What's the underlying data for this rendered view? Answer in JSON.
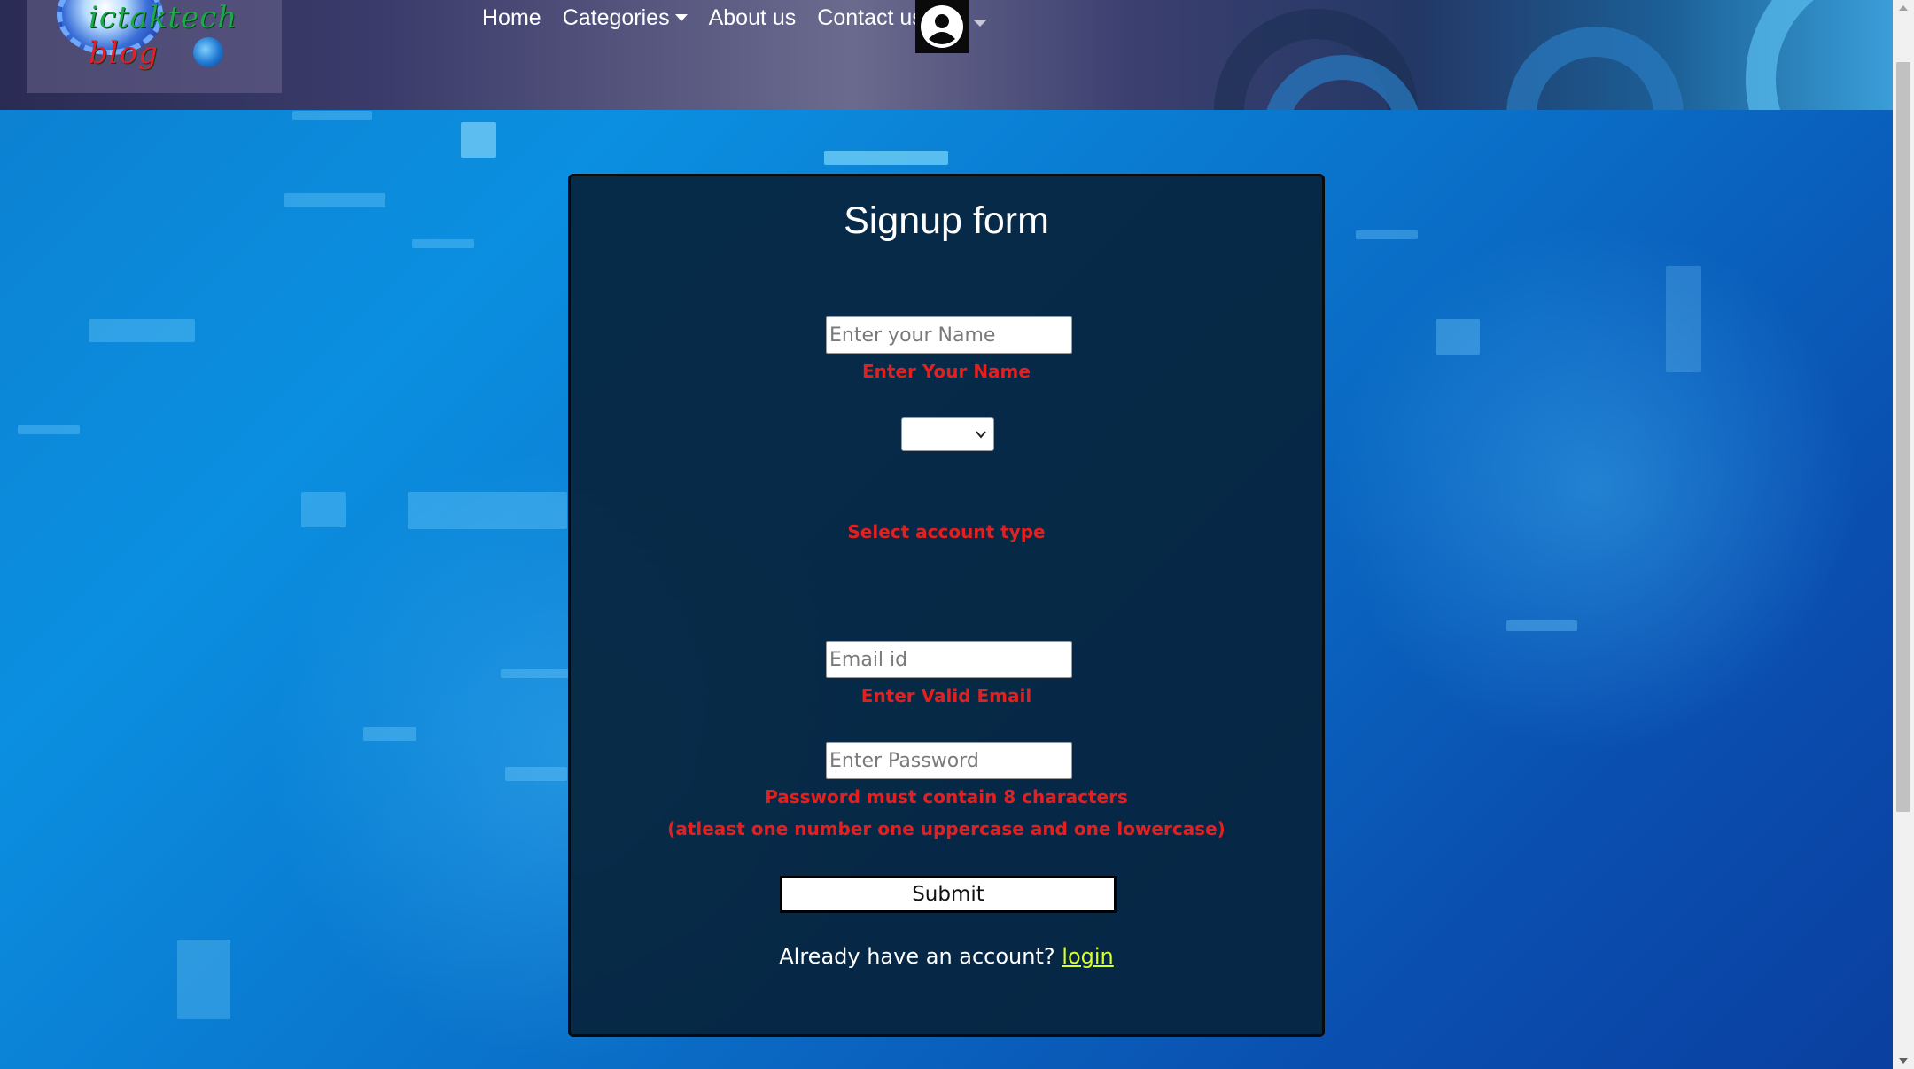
{
  "navbar": {
    "logo_text": "ictaktech blog",
    "links": {
      "home": "Home",
      "categories": "Categories",
      "about": "About us",
      "contact": "Contact us"
    }
  },
  "form": {
    "title": "Signup form",
    "name_placeholder": "Enter your Name",
    "name_error": "Enter Your Name",
    "account_type_value": "",
    "account_type_error": "Select account type",
    "email_placeholder": "Email id",
    "email_error": "Enter Valid Email",
    "password_placeholder": "Enter Password",
    "password_error_line1": "Password must contain 8 characters",
    "password_error_line2": "(atleast one number one uppercase and one lowercase)",
    "submit_label": "Submit",
    "already_text": "Already have an account?",
    "login_label": "login"
  },
  "colors": {
    "error": "#e32020",
    "link": "#d8ff2a",
    "card_bg": "#06243c"
  },
  "icons": {
    "profile": "user-avatar-icon",
    "dropdown": "caret-down-icon",
    "select": "chevron-down-icon"
  }
}
